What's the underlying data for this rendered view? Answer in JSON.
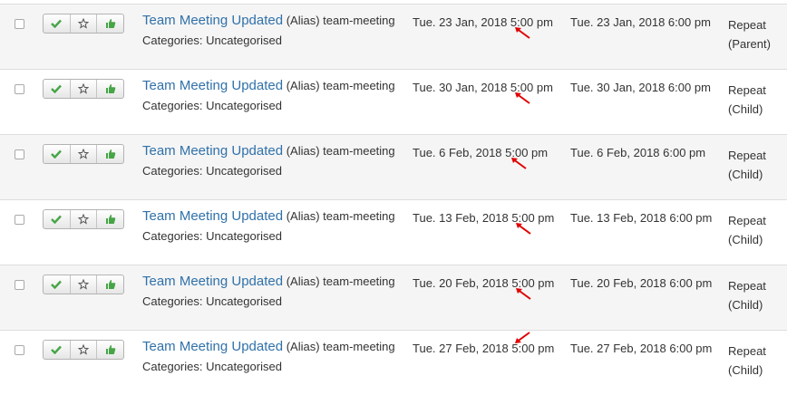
{
  "rows": [
    {
      "title": "Team Meeting Updated",
      "alias": "(Alias) team-meeting",
      "categories": "Categories: Uncategorised",
      "start": "Tue. 23 Jan, 2018 5:00 pm",
      "end": "Tue. 23 Jan, 2018 6:00 pm",
      "repeat": "Repeat",
      "repeat_type": "(Parent)"
    },
    {
      "title": "Team Meeting Updated",
      "alias": "(Alias) team-meeting",
      "categories": "Categories: Uncategorised",
      "start": "Tue. 30 Jan, 2018 5:00 pm",
      "end": "Tue. 30 Jan, 2018 6:00 pm",
      "repeat": "Repeat",
      "repeat_type": "(Child)"
    },
    {
      "title": "Team Meeting Updated",
      "alias": "(Alias) team-meeting",
      "categories": "Categories: Uncategorised",
      "start": "Tue. 6 Feb, 2018 5:00 pm",
      "end": "Tue. 6 Feb, 2018 6:00 pm",
      "repeat": "Repeat",
      "repeat_type": "(Child)"
    },
    {
      "title": "Team Meeting Updated",
      "alias": "(Alias) team-meeting",
      "categories": "Categories: Uncategorised",
      "start": "Tue. 13 Feb, 2018 5:00 pm",
      "end": "Tue. 13 Feb, 2018 6:00 pm",
      "repeat": "Repeat",
      "repeat_type": "(Child)"
    },
    {
      "title": "Team Meeting Updated",
      "alias": "(Alias) team-meeting",
      "categories": "Categories: Uncategorised",
      "start": "Tue. 20 Feb, 2018 5:00 pm",
      "end": "Tue. 20 Feb, 2018 6:00 pm",
      "repeat": "Repeat",
      "repeat_type": "(Child)"
    },
    {
      "title": "Team Meeting Updated",
      "alias": "(Alias) team-meeting",
      "categories": "Categories: Uncategorised",
      "start": "Tue. 27 Feb, 2018 5:00 pm",
      "end": "Tue. 27 Feb, 2018 6:00 pm",
      "repeat": "Repeat",
      "repeat_type": "(Child)"
    }
  ],
  "icons": {
    "publish": "check-icon",
    "feature": "star-icon",
    "like": "thumbs-up-icon",
    "annotation": "red-arrow-icon"
  },
  "colors": {
    "link": "#3071a9",
    "check": "#46a546",
    "thumb": "#46a546",
    "arrow": "#e00000",
    "row_alt": "#f5f5f5"
  }
}
